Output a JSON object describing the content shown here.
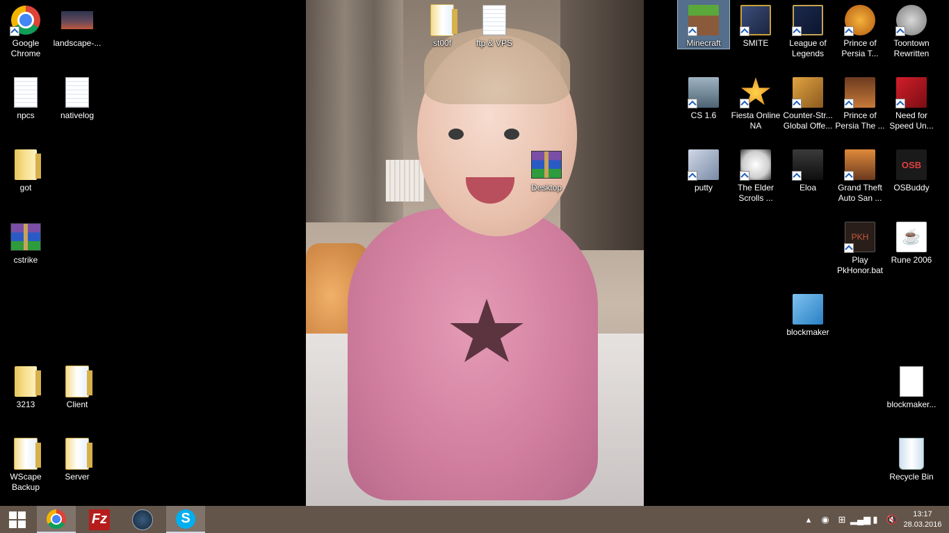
{
  "desktop": {
    "left_icons": [
      {
        "label": "Google Chrome",
        "icon": "chrome-icon"
      },
      {
        "label": "landscape-...",
        "icon": "image-icon"
      },
      {
        "label": "npcs",
        "icon": "text-file-icon"
      },
      {
        "label": "nativelog",
        "icon": "text-file-icon"
      },
      {
        "label": "got",
        "icon": "folder-icon"
      },
      {
        "label": "cstrike",
        "icon": "winrar-icon"
      },
      {
        "label": "3213",
        "icon": "folder-icon"
      },
      {
        "label": "Client",
        "icon": "folder-icon"
      },
      {
        "label": "WScape Backup",
        "icon": "folder-icon"
      },
      {
        "label": "Server",
        "icon": "folder-icon"
      }
    ],
    "center_icons": [
      {
        "label": "st00f",
        "icon": "folder-icon"
      },
      {
        "label": "ftp & VPS",
        "icon": "text-file-icon"
      },
      {
        "label": "Desktop",
        "icon": "winrar-icon"
      }
    ],
    "right_icons": [
      {
        "label": "Minecraft",
        "icon": "minecraft-icon",
        "selected": true
      },
      {
        "label": "SMITE",
        "icon": "smite-icon"
      },
      {
        "label": "League of Legends",
        "icon": "league-of-legends-icon"
      },
      {
        "label": "Prince of Persia T...",
        "icon": "prince-of-persia-icon"
      },
      {
        "label": "Toontown Rewritten",
        "icon": "toontown-icon"
      },
      {
        "label": "CS 1.6",
        "icon": "counter-strike-icon"
      },
      {
        "label": "Fiesta Online NA",
        "icon": "fiesta-online-icon"
      },
      {
        "label": "Counter-Str... Global Offe...",
        "icon": "csgo-icon"
      },
      {
        "label": "Prince of Persia The ...",
        "icon": "prince-of-persia-icon"
      },
      {
        "label": "Need for Speed Un...",
        "icon": "need-for-speed-icon"
      },
      {
        "label": "putty",
        "icon": "putty-icon"
      },
      {
        "label": "The Elder Scrolls ...",
        "icon": "skyrim-icon"
      },
      {
        "label": "Eloa",
        "icon": "eloa-icon"
      },
      {
        "label": "Grand Theft Auto San ...",
        "icon": "gta-icon"
      },
      {
        "label": "OSBuddy",
        "icon": "osbuddy-icon"
      },
      {
        "label": "Play PkHonor.bat",
        "icon": "batch-file-icon"
      },
      {
        "label": "Rune 2006",
        "icon": "java-icon"
      },
      {
        "label": "blockmaker",
        "icon": "notepad-icon"
      },
      {
        "label": "blockmaker...",
        "icon": "file-icon"
      },
      {
        "label": "Recycle Bin",
        "icon": "recycle-bin-icon"
      }
    ],
    "osb_text": "OSB",
    "pkh_text": "PKH",
    "fz_text": "Fz",
    "skype_text": "S"
  },
  "taskbar": {
    "apps": [
      {
        "name": "Google Chrome",
        "icon": "chrome-icon",
        "active": true
      },
      {
        "name": "FileZilla",
        "icon": "filezilla-icon",
        "active": false
      },
      {
        "name": "Steam",
        "icon": "steam-icon",
        "active": false
      },
      {
        "name": "Skype",
        "icon": "skype-icon",
        "active": true
      }
    ],
    "tray": {
      "icons": [
        "show-hidden-icons-chevron",
        "steam-tray-icon",
        "windows-tray-icon",
        "network-signal-icon",
        "battery-icon",
        "volume-muted-icon"
      ],
      "time": "13:17",
      "date": "28.03.2016"
    }
  },
  "colors": {
    "taskbar": "#6c5c50",
    "selection": "#99c9ff"
  }
}
